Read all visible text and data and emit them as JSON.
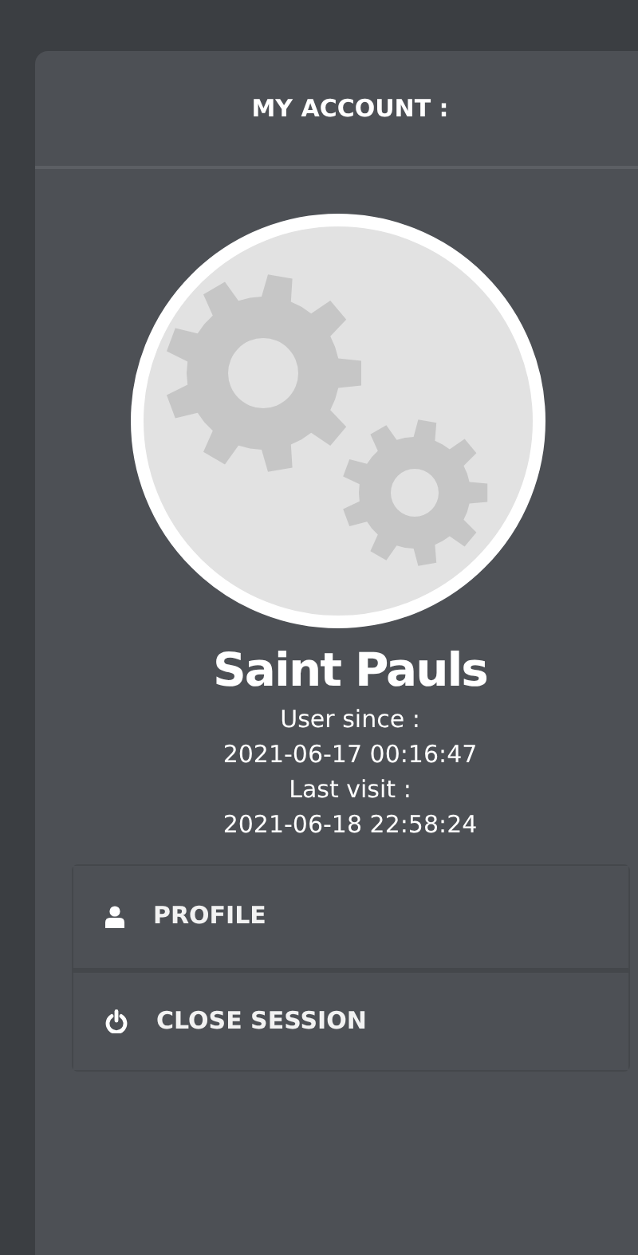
{
  "panel": {
    "title": "MY ACCOUNT :"
  },
  "user": {
    "name": "Saint Pauls",
    "since_label": "User since :",
    "since": "2021-06-17 00:16:47",
    "visit_label": "Last visit :",
    "visit": "2021-06-18 22:58:24"
  },
  "menu": [
    {
      "kind": "profile",
      "label": "PROFILE"
    },
    {
      "kind": "logout",
      "label": "CLOSE SESSION"
    }
  ]
}
